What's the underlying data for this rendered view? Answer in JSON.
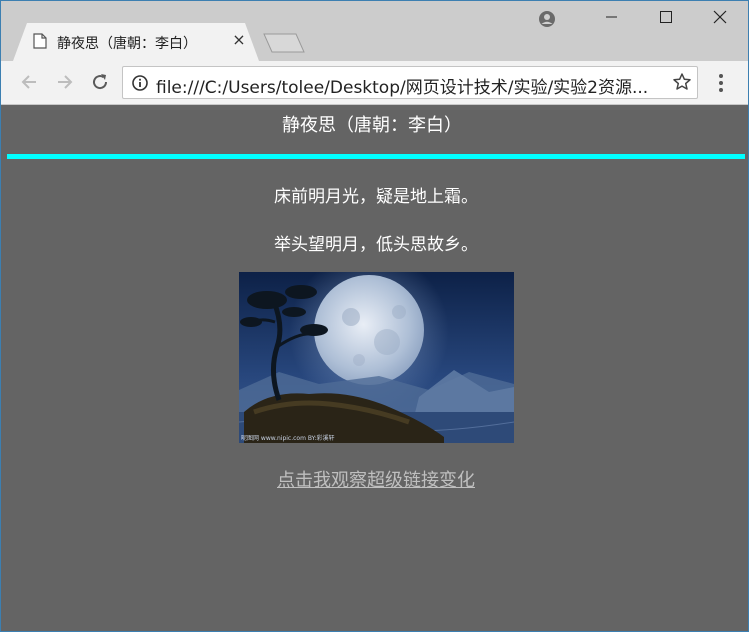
{
  "browser": {
    "tab_title": "静夜思（唐朝：李白）",
    "tab_close": "×",
    "url": "file:///C:/Users/tolee/Desktop/网页设计技术/实验/实验2资源..."
  },
  "page": {
    "title": "静夜思（唐朝：李白）",
    "lines": [
      "床前明月光，疑是地上霜。",
      "举头望明月，低头思故乡。"
    ],
    "link_text": "点击我观察超级链接变化",
    "image_watermark": "昵图网 www.nipic.com  BY:彩溪轩"
  },
  "colors": {
    "page_background": "#646464",
    "rule": "#00ffff",
    "text": "#ffffff",
    "link": "#bfbfbf"
  }
}
